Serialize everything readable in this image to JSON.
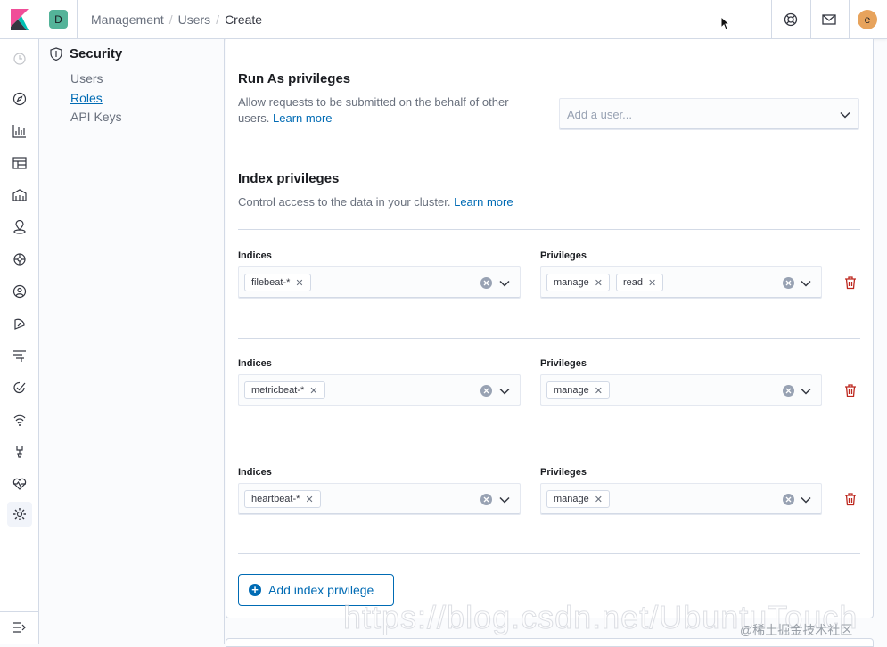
{
  "header": {
    "space_initial": "D",
    "breadcrumbs": [
      "Management",
      "Users",
      "Create"
    ],
    "avatar_initial": "e",
    "icons": [
      "help-icon",
      "mail-icon"
    ]
  },
  "nav_rail": {
    "icons": [
      "clock-icon",
      "discover-icon",
      "visualize-icon",
      "dashboard-icon",
      "canvas-icon",
      "maps-icon",
      "ml-icon",
      "infra-icon",
      "logs-icon",
      "apm-icon",
      "uptime-icon",
      "siem-icon",
      "dev-tools-icon",
      "monitoring-icon",
      "management-icon"
    ],
    "collapse_icon": "menu-collapse-icon"
  },
  "sidenav": {
    "title": "Security",
    "items": [
      {
        "label": "Users",
        "active": false
      },
      {
        "label": "Roles",
        "active": true
      },
      {
        "label": "API Keys",
        "active": false
      }
    ]
  },
  "run_as": {
    "title": "Run As privileges",
    "desc": "Allow requests to be submitted on the behalf of other users.",
    "learn_more": "Learn more",
    "placeholder": "Add a user..."
  },
  "index_privileges": {
    "title": "Index privileges",
    "desc": "Control access to the data in your cluster.",
    "learn_more": "Learn more",
    "indices_label": "Indices",
    "privileges_label": "Privileges",
    "rows": [
      {
        "indices": [
          "filebeat-*"
        ],
        "privileges": [
          "manage",
          "read"
        ]
      },
      {
        "indices": [
          "metricbeat-*"
        ],
        "privileges": [
          "manage"
        ]
      },
      {
        "indices": [
          "heartbeat-*"
        ],
        "privileges": [
          "manage"
        ]
      }
    ],
    "add_button": "Add index privilege"
  },
  "watermark": {
    "url": "https://blog.csdn.net/UbuntuTouch",
    "credit": "@稀土掘金技术社区"
  },
  "colors": {
    "accent": "#006bb4",
    "danger": "#bd271e",
    "space_badge": "#54b399",
    "avatar": "#e7a35c"
  }
}
